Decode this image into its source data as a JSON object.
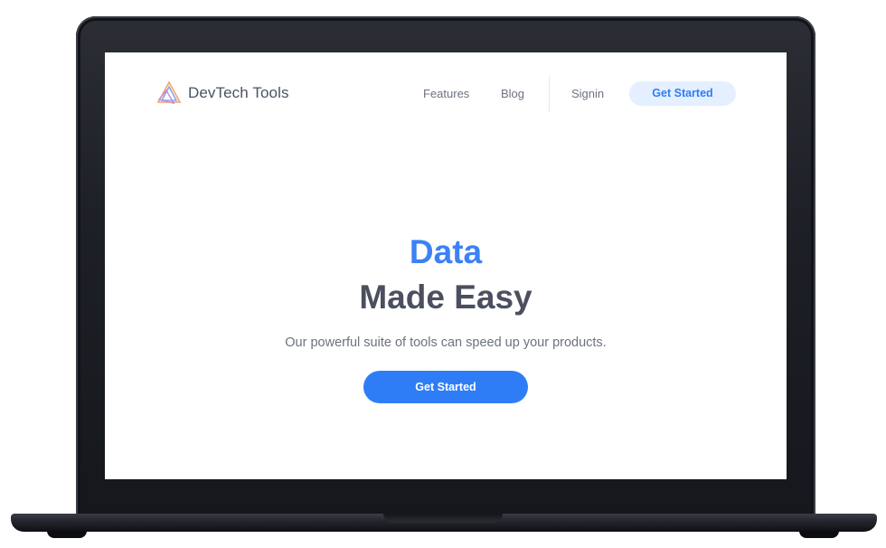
{
  "brand": {
    "name": "DevTech Tools",
    "icon": "triangle-logo-icon"
  },
  "nav": {
    "features": "Features",
    "blog": "Blog",
    "signin": "Signin",
    "cta": "Get Started"
  },
  "hero": {
    "title_highlight": "Data",
    "title_rest": "Made Easy",
    "subtitle": "Our powerful suite of tools can speed up your products.",
    "cta": "Get Started"
  },
  "colors": {
    "accent": "#2f7df6",
    "accent_soft": "#e4efff",
    "heading": "#4b5060",
    "text": "#6b7280",
    "device_frame": "#1d2026"
  }
}
